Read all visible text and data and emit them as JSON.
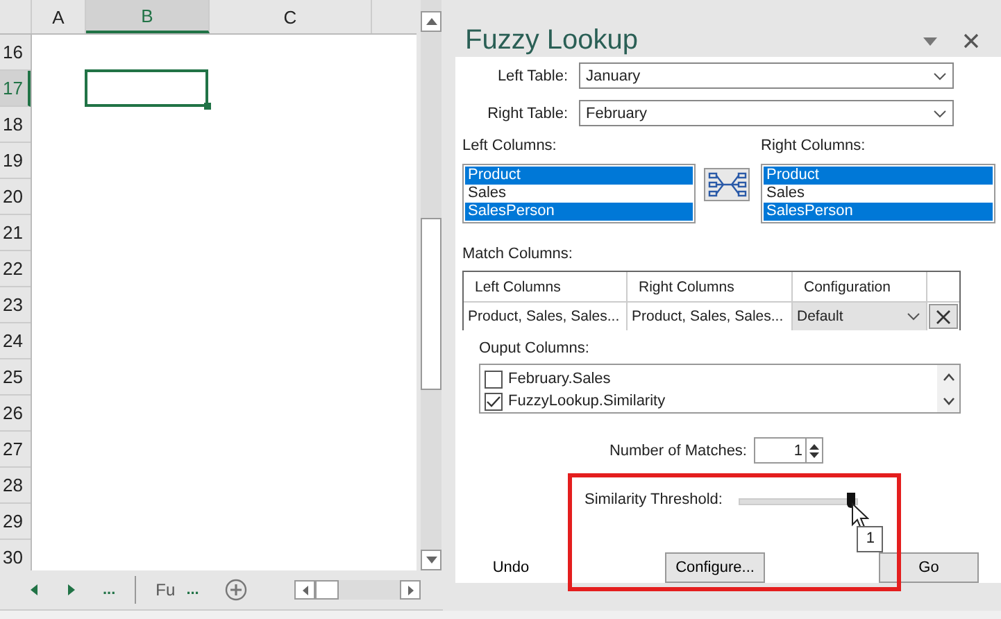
{
  "sheet": {
    "columns": [
      {
        "label": "A",
        "selected": false
      },
      {
        "label": "B",
        "selected": true
      },
      {
        "label": "C",
        "selected": false
      }
    ],
    "rows": [
      {
        "label": "16",
        "selected": false
      },
      {
        "label": "17",
        "selected": true
      },
      {
        "label": "18",
        "selected": false
      },
      {
        "label": "19",
        "selected": false
      },
      {
        "label": "20",
        "selected": false
      },
      {
        "label": "21",
        "selected": false
      },
      {
        "label": "22",
        "selected": false
      },
      {
        "label": "23",
        "selected": false
      },
      {
        "label": "24",
        "selected": false
      },
      {
        "label": "25",
        "selected": false
      },
      {
        "label": "26",
        "selected": false
      },
      {
        "label": "27",
        "selected": false
      },
      {
        "label": "28",
        "selected": false
      },
      {
        "label": "29",
        "selected": false
      },
      {
        "label": "30",
        "selected": false
      }
    ],
    "tab_bar": {
      "more_left": "...",
      "sheet_tab": "Fu",
      "more_right": "..."
    }
  },
  "panel": {
    "title": "Fuzzy Lookup",
    "left_table": {
      "label": "Left Table:",
      "value": "January"
    },
    "right_table": {
      "label": "Right Table:",
      "value": "February"
    },
    "left_columns": {
      "label": "Left Columns:",
      "items": [
        {
          "text": "Product",
          "selected": true
        },
        {
          "text": "Sales",
          "selected": false
        },
        {
          "text": "SalesPerson",
          "selected": true
        }
      ]
    },
    "right_columns": {
      "label": "Right Columns:",
      "items": [
        {
          "text": "Product",
          "selected": true
        },
        {
          "text": "Sales",
          "selected": false
        },
        {
          "text": "SalesPerson",
          "selected": true
        }
      ]
    },
    "match_columns": {
      "label": "Match Columns:",
      "headers": [
        "Left Columns",
        "Right Columns",
        "Configuration"
      ],
      "rows": [
        {
          "left": "Product, Sales, Sales...",
          "right": "Product, Sales, Sales...",
          "configuration": "Default"
        }
      ]
    },
    "output_columns": {
      "label": "Ouput Columns:",
      "items": [
        {
          "text": "February.Sales",
          "checked": false
        },
        {
          "text": "FuzzyLookup.Similarity",
          "checked": true
        }
      ]
    },
    "number_of_matches": {
      "label": "Number of Matches:",
      "value": "1"
    },
    "similarity_threshold": {
      "label": "Similarity Threshold:",
      "level": 1.0,
      "tooltip": "1"
    },
    "buttons": {
      "undo": "Undo",
      "configure": "Configure...",
      "go": "Go"
    }
  }
}
